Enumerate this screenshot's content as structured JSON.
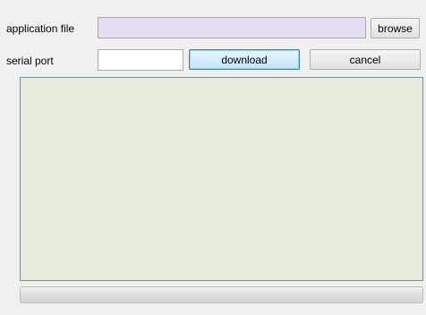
{
  "form": {
    "application_file": {
      "label": "application file",
      "value": "",
      "placeholder": ""
    },
    "serial_port": {
      "label": "serial port",
      "value": "",
      "placeholder": ""
    }
  },
  "buttons": {
    "browse": "browse",
    "download": "download",
    "cancel": "cancel"
  },
  "log": {
    "text": ""
  },
  "progress": {
    "fraction": 0
  },
  "colors": {
    "window_bg": "#f0f0f0",
    "file_field_bg": "#e6def0",
    "port_field_bg": "#ffffff",
    "log_bg": "#e5eddc",
    "download_button_accent": "#bee6fd"
  },
  "icons": {}
}
